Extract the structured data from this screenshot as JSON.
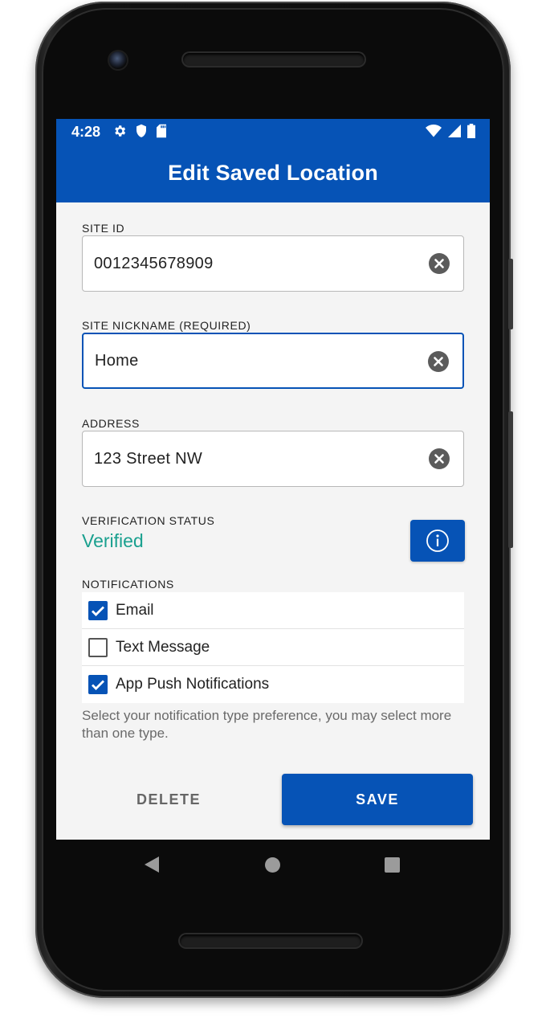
{
  "status_bar": {
    "time": "4:28",
    "icons_left": [
      "gear-icon",
      "shield-icon",
      "sd-card-icon"
    ],
    "icons_right": [
      "wifi-icon",
      "signal-icon",
      "battery-icon"
    ]
  },
  "header": {
    "title": "Edit Saved Location"
  },
  "fields": {
    "site_id": {
      "label": "SITE ID",
      "value": "0012345678909"
    },
    "site_nickname": {
      "label": "SITE NICKNAME (REQUIRED)",
      "value": "Home"
    },
    "address": {
      "label": "ADDRESS",
      "value": "123 Street NW"
    }
  },
  "verification": {
    "label": "VERIFICATION STATUS",
    "value": "Verified",
    "color": "#1aa08f"
  },
  "notifications": {
    "label": "NOTIFICATIONS",
    "options": [
      {
        "label": "Email",
        "checked": true
      },
      {
        "label": "Text Message",
        "checked": false
      },
      {
        "label": "App Push Notifications",
        "checked": true
      }
    ],
    "help_text": "Select your notification type preference, you may select more than one type."
  },
  "actions": {
    "delete_label": "DELETE",
    "save_label": "SAVE"
  },
  "colors": {
    "primary": "#0653b6",
    "background": "#f4f4f4"
  }
}
